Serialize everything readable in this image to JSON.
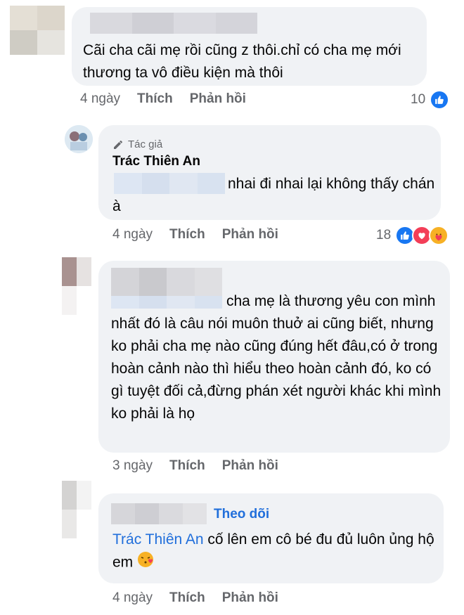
{
  "comments": [
    {
      "text": "Cãi cha cãi mẹ rồi cũng z thôi.chỉ có cha mẹ mới thương ta vô điều kiện mà thôi",
      "time": "4 ngày",
      "like": "Thích",
      "reply": "Phản hồi",
      "reaction_count": "10"
    },
    {
      "author_tag": "Tác giả",
      "author": "Trác Thiên An",
      "text": "nhai đi nhai lại không thấy chán à",
      "time": "4 ngày",
      "like": "Thích",
      "reply": "Phản hồi",
      "reaction_count": "18"
    },
    {
      "text": "cha mẹ là thương yêu con mình nhất đó là câu nói muôn thuở ai cũng biết, nhưng ko phải cha mẹ nào cũng đúng hết đâu,có ở trong hoàn cảnh nào thì hiểu theo hoàn cảnh đó, ko có gì tuyệt đối cả,đừng phán xét người khác khi mình ko phải là họ",
      "time": "3 ngày",
      "like": "Thích",
      "reply": "Phản hồi"
    },
    {
      "follow": "Theo dõi",
      "mention": "Trác Thiên An",
      "text": "cố lên em cô bé đu đủ luôn ủng hộ em",
      "time": "4 ngày",
      "like": "Thích",
      "reply": "Phản hồi"
    }
  ],
  "colors": {
    "bubble": "#f0f2f5",
    "meta": "#65676b",
    "like_blue": "#1877f2",
    "love_red": "#f33e58",
    "link": "#216fdb"
  },
  "icons": [
    "like-icon",
    "love-icon",
    "care-icon",
    "pencil-icon",
    "kiss-emoji-icon"
  ]
}
